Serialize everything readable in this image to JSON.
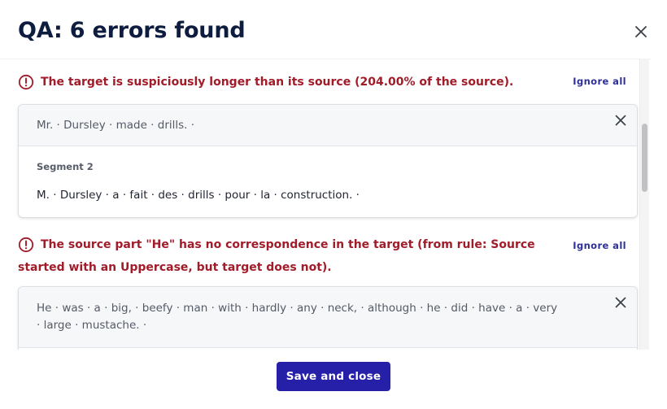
{
  "dialog": {
    "title": "QA: 6 errors found",
    "save_label": "Save and close"
  },
  "errors": [
    {
      "message": "The target is suspiciously longer than its source (204.00% of the source).",
      "ignore_label": "Ignore all",
      "source_text": "Mr. · Dursley · made · drills. ·",
      "segment_label": "Segment 2",
      "target_text": "M. · Dursley · a · fait · des · drills · pour · la · construction. ·"
    },
    {
      "message": "The source part \"He\" has no correspondence in the target (from rule: Source started with an Uppercase, but target does not).",
      "ignore_label": "Ignore all",
      "source_text": "He · was · a · big, · beefy · man · with · hardly · any · neck, · although · he · did · have · a · very · large · mustache. ·"
    }
  ],
  "colors": {
    "error": "#a11b29",
    "primary": "#2620a8",
    "title": "#0e1d3f"
  }
}
